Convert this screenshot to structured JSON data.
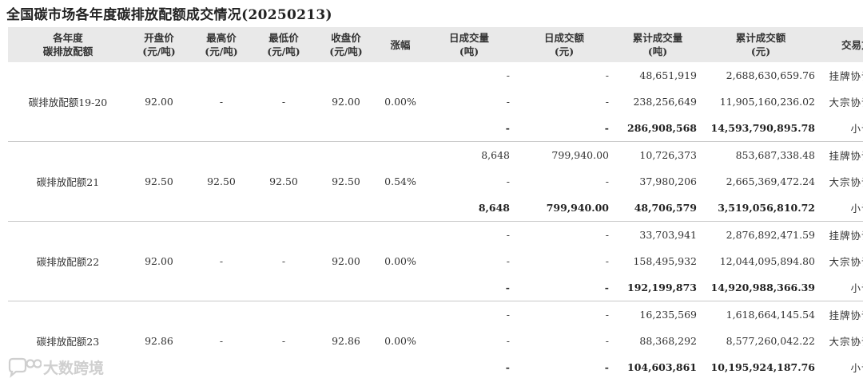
{
  "title": "全国碳市场各年度碳排放配额成交情况(20250213)",
  "columns": {
    "c1": [
      "各年度",
      "碳排放配额"
    ],
    "c2": [
      "开盘价",
      "(元/吨)"
    ],
    "c3": [
      "最高价",
      "(元/吨)"
    ],
    "c4": [
      "最低价",
      "(元/吨)"
    ],
    "c5": [
      "收盘价",
      "(元/吨)"
    ],
    "c6": [
      "涨幅"
    ],
    "c7": [
      "日成交量",
      "(吨)"
    ],
    "c8": [
      "日成交额",
      "(元)"
    ],
    "c9": [
      "累计成交量",
      "(吨)"
    ],
    "c10": [
      "累计成交额",
      "(元)"
    ],
    "c11": [
      "交易方式"
    ]
  },
  "groups": [
    {
      "name": "碳排放配额19-20",
      "open": "92.00",
      "high": "-",
      "low": "-",
      "close": "92.00",
      "change": "0.00%",
      "rows": [
        {
          "vol": "-",
          "amt": "-",
          "cum_vol": "48,651,919",
          "cum_amt": "2,688,630,659.76",
          "mode": "挂牌协议交易"
        },
        {
          "vol": "-",
          "amt": "-",
          "cum_vol": "238,256,649",
          "cum_amt": "11,905,160,236.02",
          "mode": "大宗协议交易"
        },
        {
          "vol": "-",
          "amt": "-",
          "cum_vol": "286,908,568",
          "cum_amt": "14,593,790,895.78",
          "mode": "小计"
        }
      ]
    },
    {
      "name": "碳排放配额21",
      "open": "92.50",
      "high": "92.50",
      "low": "92.50",
      "close": "92.50",
      "change": "0.54%",
      "rows": [
        {
          "vol": "8,648",
          "amt": "799,940.00",
          "cum_vol": "10,726,373",
          "cum_amt": "853,687,338.48",
          "mode": "挂牌协议交易"
        },
        {
          "vol": "-",
          "amt": "-",
          "cum_vol": "37,980,206",
          "cum_amt": "2,665,369,472.24",
          "mode": "大宗协议交易"
        },
        {
          "vol": "8,648",
          "amt": "799,940.00",
          "cum_vol": "48,706,579",
          "cum_amt": "3,519,056,810.72",
          "mode": "小计"
        }
      ]
    },
    {
      "name": "碳排放配额22",
      "open": "92.00",
      "high": "-",
      "low": "-",
      "close": "92.00",
      "change": "0.00%",
      "rows": [
        {
          "vol": "-",
          "amt": "-",
          "cum_vol": "33,703,941",
          "cum_amt": "2,876,892,471.59",
          "mode": "挂牌协议交易"
        },
        {
          "vol": "-",
          "amt": "-",
          "cum_vol": "158,495,932",
          "cum_amt": "12,044,095,894.80",
          "mode": "大宗协议交易"
        },
        {
          "vol": "-",
          "amt": "-",
          "cum_vol": "192,199,873",
          "cum_amt": "14,920,988,366.39",
          "mode": "小计"
        }
      ]
    },
    {
      "name": "碳排放配额23",
      "open": "92.86",
      "high": "-",
      "low": "-",
      "close": "92.86",
      "change": "0.00%",
      "rows": [
        {
          "vol": "-",
          "amt": "-",
          "cum_vol": "16,235,569",
          "cum_amt": "1,618,664,145.54",
          "mode": "挂牌协议交易"
        },
        {
          "vol": "-",
          "amt": "-",
          "cum_vol": "88,368,292",
          "cum_amt": "8,577,260,042.22",
          "mode": "大宗协议交易"
        },
        {
          "vol": "-",
          "amt": "-",
          "cum_vol": "104,603,861",
          "cum_amt": "10,195,924,187.76",
          "mode": "小计"
        }
      ]
    }
  ],
  "watermark": {
    "text": "大数跨境",
    "icon": "chat-bubble-logo-icon"
  }
}
